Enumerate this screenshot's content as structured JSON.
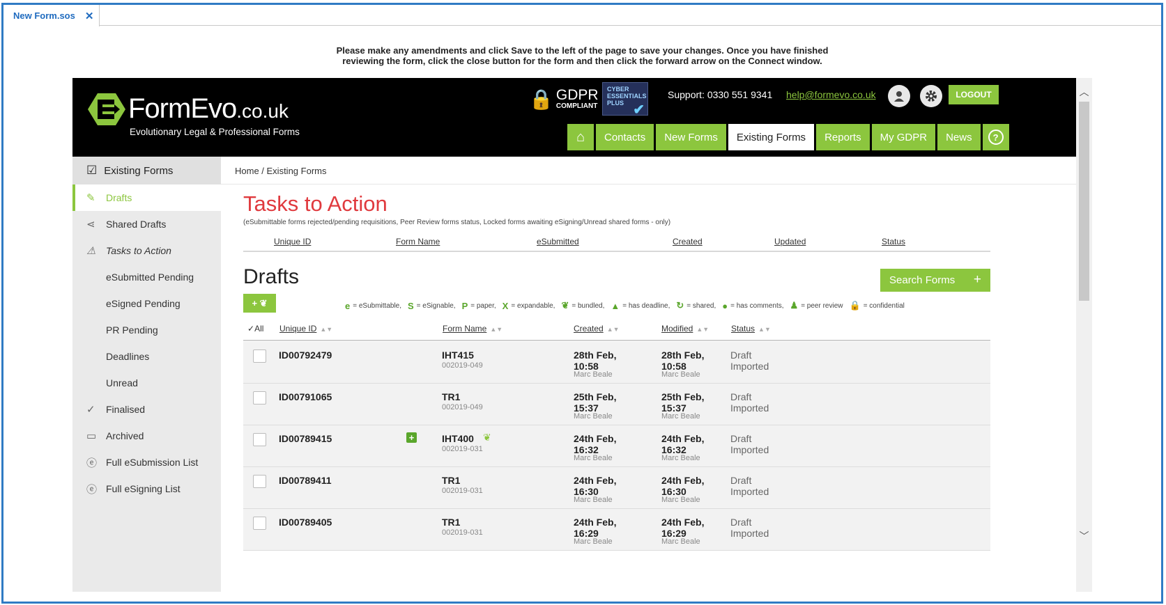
{
  "window": {
    "tab_title": "New Form.sos",
    "tab_close": "✕"
  },
  "notice": {
    "line1": "Please make any amendments and click Save to the left of the page to save your changes. Once you have finished",
    "line2": "reviewing the form, click the close button for the form and then click the forward arrow on the Connect window."
  },
  "header": {
    "logo_name": "FormEvo",
    "logo_suffix": "co.uk",
    "logo_tagline": "Evolutionary Legal & Professional Forms",
    "gdpr_main": "GDPR",
    "gdpr_sub": "COMPLIANT",
    "cyber_line1": "CYBER",
    "cyber_line2": "ESSENTIALS",
    "cyber_line3": "PLUS",
    "support": "Support: 0330 551 9341",
    "email": "help@formevo.co.uk",
    "logout": "LOGOUT",
    "nav": [
      "Contacts",
      "New Forms",
      "Existing Forms",
      "Reports",
      "My GDPR",
      "News"
    ],
    "help_glyph": "?",
    "accent_color": "#8cc63e"
  },
  "sidebar": {
    "heading": "Existing Forms",
    "items": [
      {
        "label": "Drafts",
        "icon": "pencil-icon"
      },
      {
        "label": "Shared Drafts",
        "icon": "share-icon"
      },
      {
        "label": "Tasks to Action",
        "icon": "warning-icon"
      },
      {
        "label": "eSubmitted Pending"
      },
      {
        "label": "eSigned Pending"
      },
      {
        "label": "PR Pending"
      },
      {
        "label": "Deadlines"
      },
      {
        "label": "Unread"
      },
      {
        "label": "Finalised",
        "icon": "check-icon"
      },
      {
        "label": "Archived",
        "icon": "folder-icon"
      },
      {
        "label": "Full eSubmission List",
        "icon": "e-circle-icon"
      },
      {
        "label": "Full eSigning List",
        "icon": "e-circle-icon"
      }
    ]
  },
  "breadcrumb": "Home / Existing Forms",
  "tasks": {
    "title": "Tasks to Action",
    "subtitle": "(eSubmittable forms rejected/pending requisitions, Peer Review forms status, Locked forms awaiting eSigning/Unread shared forms - only)",
    "columns": [
      "Unique ID",
      "Form Name",
      "eSubmitted",
      "Created",
      "Updated",
      "Status"
    ]
  },
  "drafts": {
    "title": "Drafts",
    "search_button": "Search Forms",
    "search_plus": "+",
    "add_label": "+",
    "legend": [
      {
        "symbol": "e",
        "text": "= eSubmittable,"
      },
      {
        "symbol": "S",
        "text": "= eSignable,"
      },
      {
        "symbol": "P",
        "text": "= paper,"
      },
      {
        "symbol": "X",
        "text": "= expandable,"
      },
      {
        "symbol": "❦",
        "text": "= bundled,"
      },
      {
        "symbol": "▲",
        "text": "= has deadline,"
      },
      {
        "symbol": "↻",
        "text": "= shared,"
      },
      {
        "symbol": "●",
        "text": "= has comments,"
      },
      {
        "symbol": "♟",
        "text": "= peer review"
      },
      {
        "symbol": "🔒",
        "text": "= confidential"
      }
    ],
    "columns": {
      "all": "All",
      "unique_id": "Unique ID",
      "form_name": "Form Name",
      "created": "Created",
      "modified": "Modified",
      "status": "Status"
    },
    "rows": [
      {
        "id": "ID00792479",
        "form": "IHT415",
        "code": "002019-049",
        "created_date": "28th Feb,",
        "created_time": "10:58",
        "created_by": "Marc Beale",
        "modified_date": "28th Feb,",
        "modified_time": "10:58",
        "modified_by": "Marc Beale",
        "status1": "Draft",
        "status2": "Imported",
        "expandable": false,
        "bundled": false
      },
      {
        "id": "ID00791065",
        "form": "TR1",
        "code": "002019-049",
        "created_date": "25th Feb,",
        "created_time": "15:37",
        "created_by": "Marc Beale",
        "modified_date": "25th Feb,",
        "modified_time": "15:37",
        "modified_by": "Marc Beale",
        "status1": "Draft",
        "status2": "Imported",
        "expandable": false,
        "bundled": false
      },
      {
        "id": "ID00789415",
        "form": "IHT400",
        "code": "002019-031",
        "created_date": "24th Feb,",
        "created_time": "16:32",
        "created_by": "Marc Beale",
        "modified_date": "24th Feb,",
        "modified_time": "16:32",
        "modified_by": "Marc Beale",
        "status1": "Draft",
        "status2": "Imported",
        "expandable": true,
        "bundled": true
      },
      {
        "id": "ID00789411",
        "form": "TR1",
        "code": "002019-031",
        "created_date": "24th Feb,",
        "created_time": "16:30",
        "created_by": "Marc Beale",
        "modified_date": "24th Feb,",
        "modified_time": "16:30",
        "modified_by": "Marc Beale",
        "status1": "Draft",
        "status2": "Imported",
        "expandable": false,
        "bundled": false
      },
      {
        "id": "ID00789405",
        "form": "TR1",
        "code": "002019-031",
        "created_date": "24th Feb,",
        "created_time": "16:29",
        "created_by": "Marc Beale",
        "modified_date": "24th Feb,",
        "modified_time": "16:29",
        "modified_by": "Marc Beale",
        "status1": "Draft",
        "status2": "Imported",
        "expandable": false,
        "bundled": false
      }
    ]
  }
}
